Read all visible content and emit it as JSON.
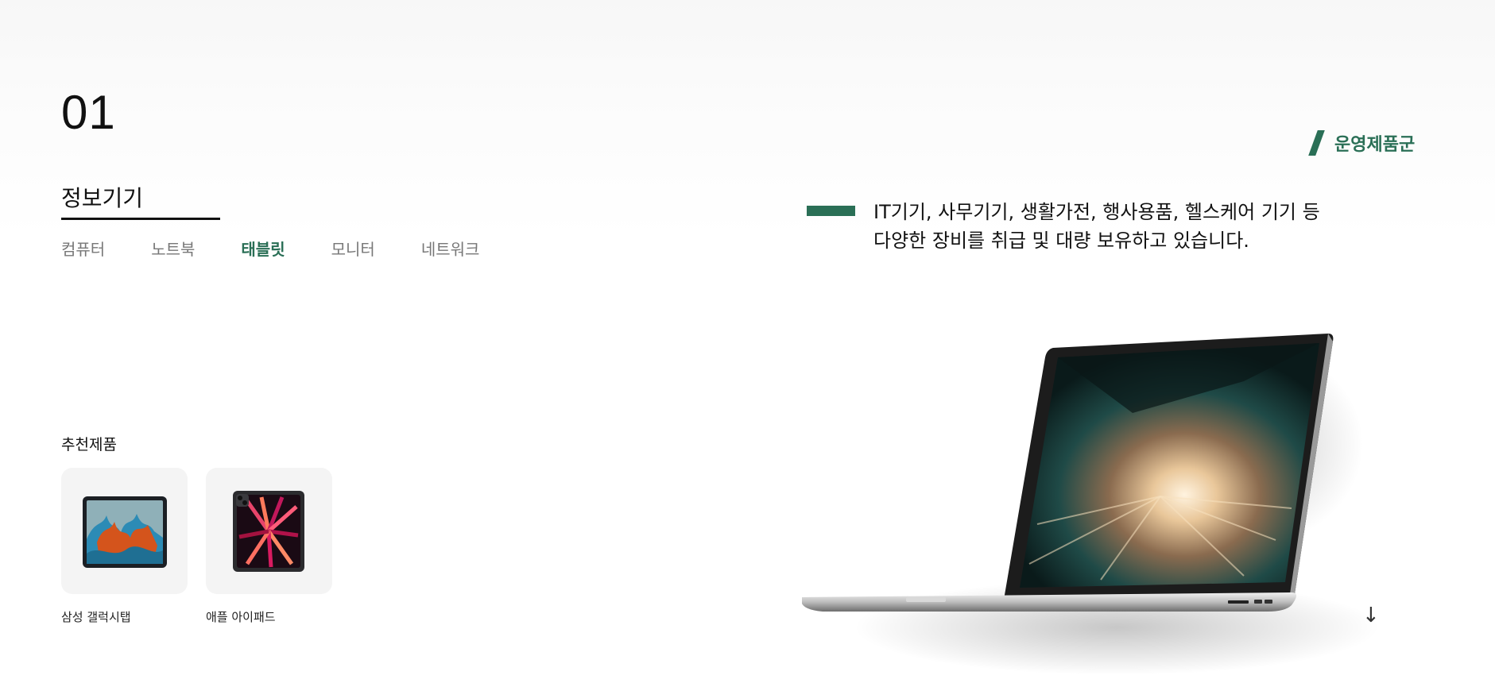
{
  "section": {
    "number": "01",
    "category_title": "정보기기"
  },
  "subtabs": [
    {
      "label": "컴퓨터",
      "active": false
    },
    {
      "label": "노트북",
      "active": false
    },
    {
      "label": "태블릿",
      "active": true
    },
    {
      "label": "모니터",
      "active": false
    },
    {
      "label": "네트워크",
      "active": false
    }
  ],
  "brand_tag": "운영제품군",
  "description": {
    "line1": "IT기기, 사무기기, 생활가전, 행사용품, 헬스케어 기기 등",
    "line2": "다양한 장비를 취급 및 대량 보유하고 있습니다."
  },
  "recommended": {
    "label": "추천제품",
    "products": [
      {
        "name": "삼성 갤럭시탭",
        "image": "samsung-tablet-image"
      },
      {
        "name": "애플 아이패드",
        "image": "ipad-image"
      }
    ]
  },
  "hero_image": "laptop-image",
  "scroll_icon": "arrow-down-icon",
  "colors": {
    "accent": "#2a6f56",
    "text": "#111111",
    "muted": "#777777",
    "card_bg": "#f4f4f4"
  }
}
